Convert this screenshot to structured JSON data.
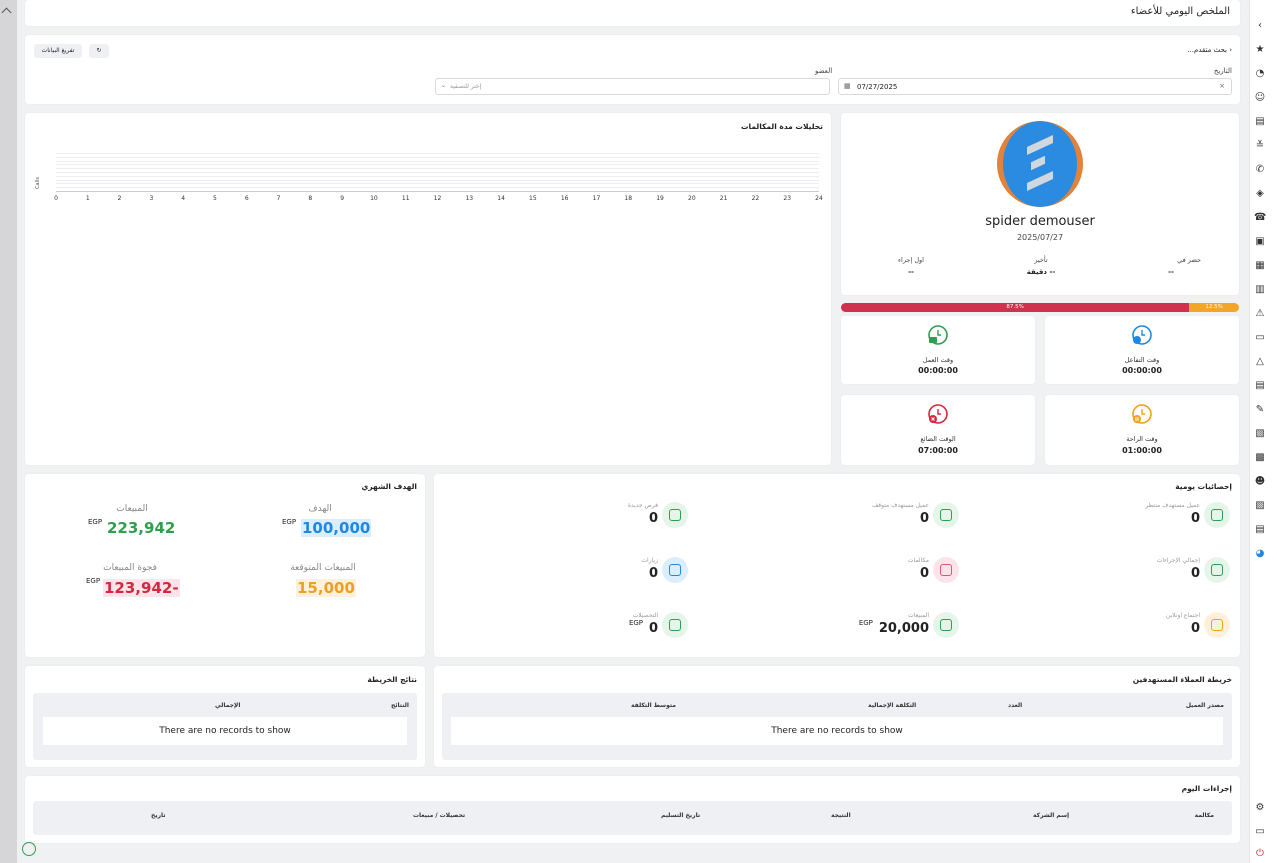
{
  "page_title": "الملخص اليومي للأعضاء",
  "filters": {
    "advanced_search": "بحث متقدم...",
    "export_label": "تفريغ البيانات",
    "date_label": "التاريخ",
    "date_value": "07/27/2025",
    "member_label": "العضو",
    "member_placeholder": "إختر للتصفية"
  },
  "profile": {
    "name": "spider demouser",
    "date": "2025/07/27",
    "attendance_label": "حضر في",
    "attendance_value": "--",
    "delay_label": "تأخير",
    "delay_value": "-- دقيقة",
    "first_action_label": "اول إجراء",
    "first_action_value": "--"
  },
  "progress": {
    "red_pct": 87.5,
    "red_label": "87.5%",
    "orange_pct": 12.5,
    "orange_label": "12.5%"
  },
  "time_cards": [
    {
      "label": "وقت التفاعل",
      "value": "00:00:00",
      "color": "#1e88e5"
    },
    {
      "label": "وقت العمل",
      "value": "00:00:00",
      "color": "#2e9e4f"
    },
    {
      "label": "وقت الراحة",
      "value": "01:00:00",
      "color": "#f0a020"
    },
    {
      "label": "الوقت الضائع",
      "value": "07:00:00",
      "color": "#d7263d"
    }
  ],
  "call_chart": {
    "title": "تحليلات مدة المكالمات",
    "ylabel": "Calls",
    "x_ticks": [
      "0",
      "1",
      "2",
      "3",
      "4",
      "5",
      "6",
      "7",
      "8",
      "9",
      "10",
      "11",
      "12",
      "13",
      "14",
      "15",
      "16",
      "17",
      "18",
      "19",
      "20",
      "21",
      "22",
      "23",
      "24"
    ]
  },
  "chart_data": {
    "type": "bar",
    "title": "تحليلات مدة المكالمات",
    "xlabel": "",
    "ylabel": "Calls",
    "categories": [
      "0",
      "1",
      "2",
      "3",
      "4",
      "5",
      "6",
      "7",
      "8",
      "9",
      "10",
      "11",
      "12",
      "13",
      "14",
      "15",
      "16",
      "17",
      "18",
      "19",
      "20",
      "21",
      "22",
      "23",
      "24"
    ],
    "values": [],
    "grid": true
  },
  "daily_stats": {
    "title": "إحصائيات يومية",
    "items": [
      {
        "label": "عميل مستهدف منتظر",
        "value": "0",
        "bg": "#e6f5ea",
        "fg": "#2e9e4f",
        "icon": "user-plus-icon"
      },
      {
        "label": "عميل مستهدف متوقف",
        "value": "0",
        "bg": "#e6f5ea",
        "fg": "#2e9e4f",
        "icon": "users-pause-icon"
      },
      {
        "label": "فرص جديدة",
        "value": "0",
        "bg": "#e6f5ea",
        "fg": "#2e9e4f",
        "icon": "user-check-icon"
      },
      {
        "label": "إجمالي الإجراءات",
        "value": "0",
        "bg": "#e6f5ea",
        "fg": "#2e9e4f",
        "icon": "grid-icon"
      },
      {
        "label": "مكالمات",
        "value": "0",
        "bg": "#fde3ea",
        "fg": "#e05577",
        "icon": "phone-icon"
      },
      {
        "label": "زيارات",
        "value": "0",
        "bg": "#dbeefd",
        "fg": "#1e88e5",
        "icon": "handshake-icon"
      },
      {
        "label": "اجتماع اونلاين",
        "value": "0",
        "bg": "#fdf1dc",
        "fg": "#f0a020",
        "icon": "video-icon"
      },
      {
        "label": "المبيعات",
        "value": "20,000",
        "currency": "EGP",
        "bg": "#e6f5ea",
        "fg": "#2e9e4f",
        "icon": "cash-icon"
      },
      {
        "label": "التحصيلات",
        "value": "0",
        "currency": "EGP",
        "bg": "#e6f5ea",
        "fg": "#2e9e4f",
        "icon": "money-doc-icon"
      }
    ]
  },
  "monthly_target": {
    "title": "الهدف الشهري",
    "target_label": "الهدف",
    "target_value": "100,000",
    "target_currency": "EGP",
    "sales_label": "المبيعات",
    "sales_value": "223,942",
    "sales_currency": "EGP",
    "expected_label": "المبيعات المتوقعة",
    "expected_value": "15,000",
    "gap_label": "فجوة المبيعات",
    "gap_value": "123,942-",
    "gap_currency": "EGP"
  },
  "leads_map": {
    "title": "خريطة العملاء المستهدفين",
    "columns": [
      "مصدر العميل",
      "العدد",
      "التكلفة الإجمالية",
      "متوسط التكلفة"
    ],
    "empty": "There are no records to show"
  },
  "map_results": {
    "title": "نتائج الخريطة",
    "columns": [
      "النتائج",
      "الإجمالي"
    ],
    "empty": "There are no records to show"
  },
  "today_actions": {
    "title": "إجراءات اليوم",
    "columns": [
      "مكالمة",
      "إسم الشركة",
      "النتيجة",
      "تاريخ التسليم",
      "تحصيلات / مبيعات",
      "تاريخ"
    ]
  }
}
